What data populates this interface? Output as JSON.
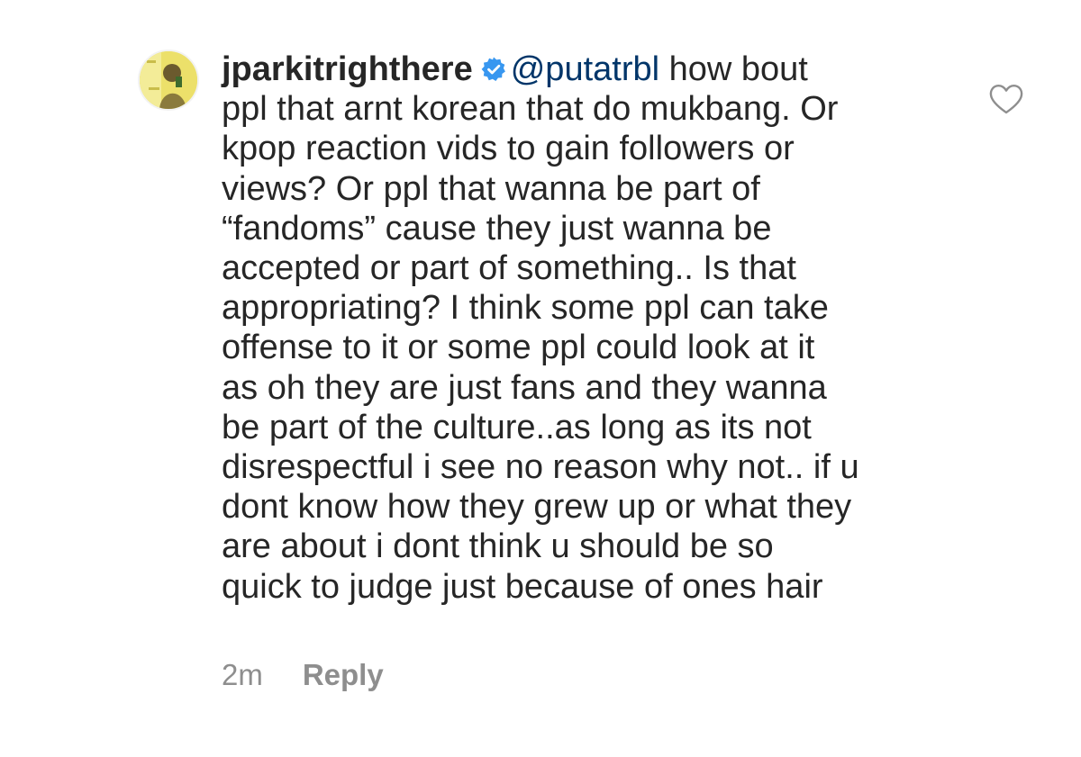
{
  "comment": {
    "username": "jparkitrighthere",
    "mention": "@putatrbl",
    "lines": [
      " how bout",
      "ppl that arnt korean that do mukbang. Or",
      "kpop reaction vids to gain followers or",
      "views? Or ppl that wanna be part of",
      "“fandoms” cause they just wanna be",
      "accepted or part of something.. Is that",
      "appropriating? I think some ppl can take",
      "offense to it or some ppl could look at it",
      "as oh they are just fans and they wanna",
      "be part of the culture..as long as its not",
      "disrespectful i see no reason why not.. if u",
      "dont know how they grew up or what they",
      "are about i dont think u should be so",
      "quick to judge just because of ones hair"
    ],
    "timestamp": "2m",
    "reply_label": "Reply"
  },
  "icons": {
    "verified": "verified-badge-icon",
    "like": "heart-outline-icon"
  },
  "colors": {
    "text": "#262626",
    "mention": "#003569",
    "verified": "#3897f0",
    "meta": "#8e8e8e"
  }
}
